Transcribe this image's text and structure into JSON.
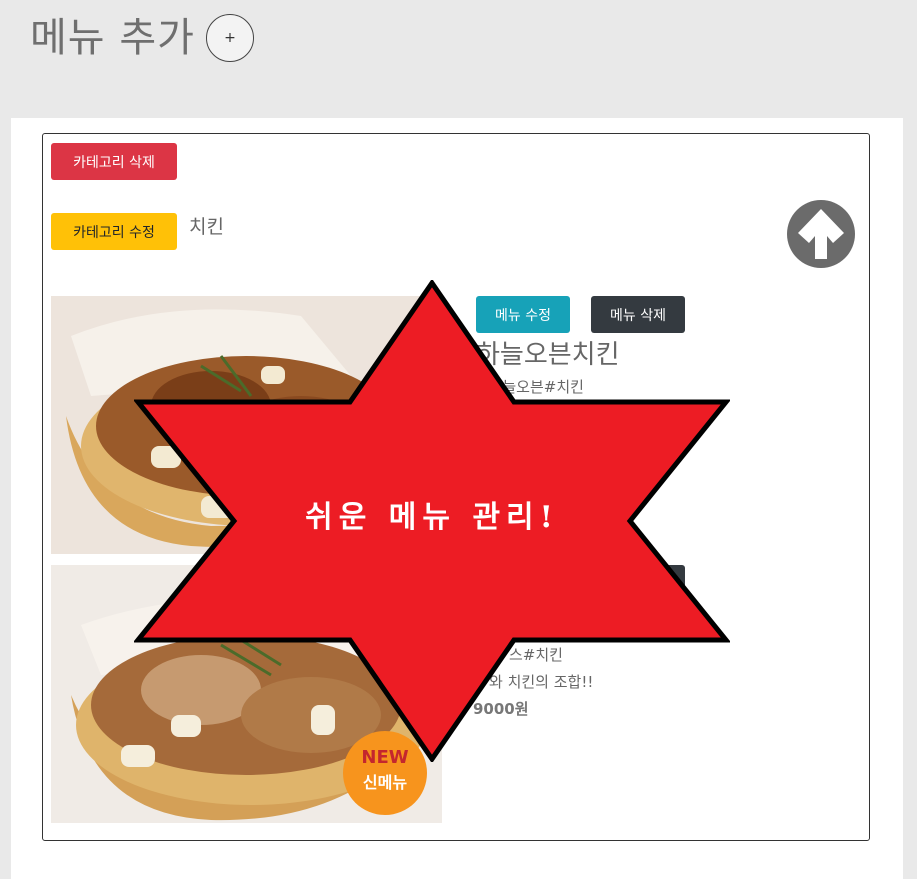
{
  "header": {
    "title": "메뉴 추가",
    "add_label": "+"
  },
  "category": {
    "delete_label": "카테고리 삭제",
    "edit_label": "카테고리 수정",
    "name": "치킨"
  },
  "menus": [
    {
      "edit_label": "메뉴 수정",
      "delete_label": "메뉴 삭제",
      "name": "하늘오븐치킨",
      "tags": "#하늘오븐#치킨"
    },
    {
      "tags": "스#치킨",
      "desc": "와 치킨의 조합!!",
      "price": "9000원",
      "badge_new": "NEW",
      "badge_label": "신메뉴"
    }
  ],
  "overlay": {
    "text": "쉬운 메뉴 관리!"
  },
  "colors": {
    "danger": "#dc3545",
    "warning": "#ffc107",
    "info": "#17a2b8",
    "dark": "#343a40",
    "star": "#ed1c24",
    "badge": "#f7941d"
  }
}
